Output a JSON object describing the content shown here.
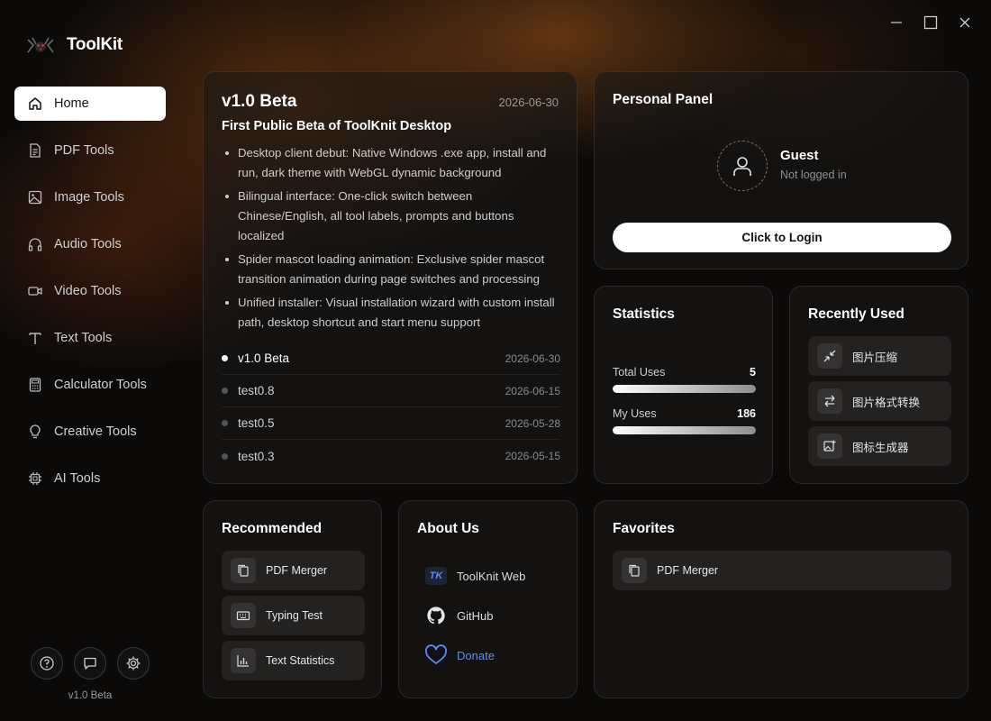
{
  "app": {
    "name": "ToolKit"
  },
  "sidebar": {
    "items": [
      {
        "label": "Home",
        "icon": "home-icon",
        "active": true
      },
      {
        "label": "PDF Tools",
        "icon": "pdf-icon"
      },
      {
        "label": "Image Tools",
        "icon": "image-icon"
      },
      {
        "label": "Audio Tools",
        "icon": "headphones-icon"
      },
      {
        "label": "Video Tools",
        "icon": "video-icon"
      },
      {
        "label": "Text Tools",
        "icon": "text-icon"
      },
      {
        "label": "Calculator Tools",
        "icon": "calculator-icon"
      },
      {
        "label": "Creative Tools",
        "icon": "lightbulb-icon"
      },
      {
        "label": "AI Tools",
        "icon": "chip-icon"
      }
    ],
    "footer_buttons": [
      "help-icon",
      "feedback-icon",
      "settings-icon"
    ],
    "version": "v1.0 Beta"
  },
  "changelog": {
    "version": "v1.0 Beta",
    "date": "2026-06-30",
    "subtitle": "First Public Beta of ToolKnit Desktop",
    "bullets": [
      "Desktop client debut: Native Windows .exe app, install and run, dark theme with WebGL dynamic background",
      "Bilingual interface: One-click switch between Chinese/English, all tool labels, prompts and buttons localized",
      "Spider mascot loading animation: Exclusive spider mascot transition animation during page switches and processing",
      "Unified installer: Visual installation wizard with custom install path, desktop shortcut and start menu support"
    ],
    "versions": [
      {
        "name": "v1.0 Beta",
        "date": "2026-06-30",
        "current": true
      },
      {
        "name": "test0.8",
        "date": "2026-06-15"
      },
      {
        "name": "test0.5",
        "date": "2026-05-28"
      },
      {
        "name": "test0.3",
        "date": "2026-05-15"
      }
    ]
  },
  "personal": {
    "title": "Personal Panel",
    "name": "Guest",
    "status": "Not logged in",
    "login_label": "Click to Login"
  },
  "statistics": {
    "title": "Statistics",
    "total_label": "Total Uses",
    "total_value": "5",
    "total_fill": 1.0,
    "my_label": "My Uses",
    "my_value": "186",
    "my_fill": 1.0
  },
  "recent": {
    "title": "Recently Used",
    "items": [
      {
        "label": "图片压缩",
        "icon": "compress-icon"
      },
      {
        "label": "图片格式转换",
        "icon": "convert-icon"
      },
      {
        "label": "图标生成器",
        "icon": "icon-generator-icon"
      }
    ]
  },
  "recommended": {
    "title": "Recommended",
    "items": [
      {
        "label": "PDF Merger",
        "icon": "copy-icon"
      },
      {
        "label": "Typing Test",
        "icon": "keyboard-icon"
      },
      {
        "label": "Text Statistics",
        "icon": "bar-chart-icon"
      }
    ]
  },
  "about": {
    "title": "About Us",
    "web_label": "ToolKnit Web",
    "web_badge": "TK",
    "github_label": "GitHub",
    "donate_label": "Donate"
  },
  "favorites": {
    "title": "Favorites",
    "items": [
      {
        "label": "PDF Merger",
        "icon": "copy-icon"
      }
    ]
  },
  "colors": {
    "accent_blue": "#5b8cff",
    "active_nav_bg": "#ffffff",
    "background": "#0b0a09"
  }
}
